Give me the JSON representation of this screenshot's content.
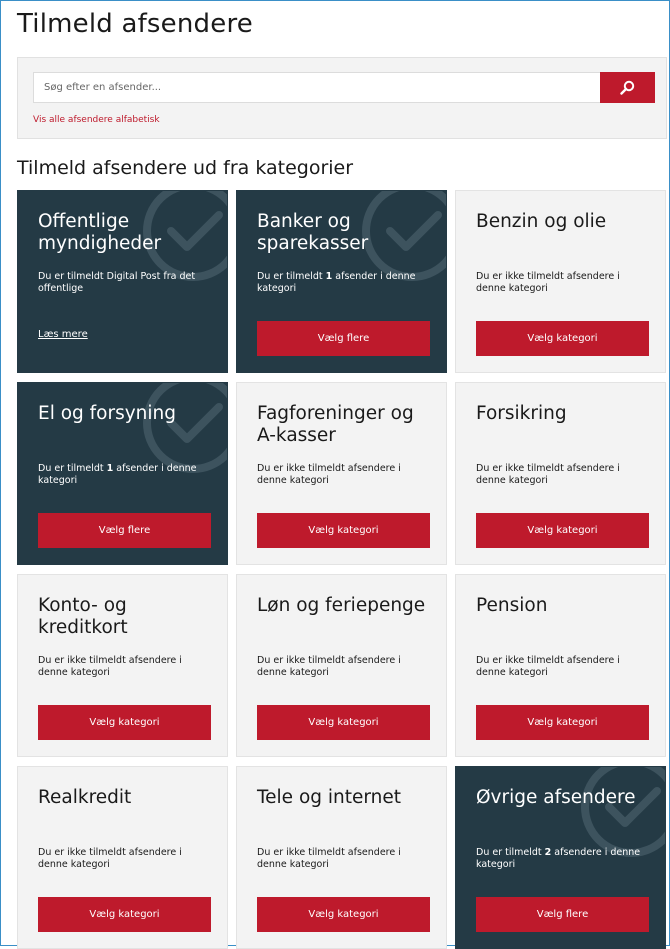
{
  "page": {
    "title": "Tilmeld afsendere",
    "section_title": "Tilmeld afsendere ud fra kategorier"
  },
  "search": {
    "placeholder": "Søg efter en afsender...",
    "button_icon": "search-icon",
    "alpha_link": "Vis alle afsendere alfabetisk"
  },
  "colors": {
    "accent": "#be1a2c",
    "dark_card": "#243a45",
    "light_card": "#f3f3f3",
    "frame": "#3a8fc7"
  },
  "categories": [
    {
      "title": "Offentlige myndigheder",
      "subscribed": true,
      "text_before": "Du er tilmeldt Digital Post fra det offentlige",
      "count": "",
      "text_after": "",
      "action_type": "link",
      "action_label": "Læs mere"
    },
    {
      "title": "Banker og sparekasser",
      "subscribed": true,
      "text_before": "Du er tilmeldt ",
      "count": "1",
      "text_after": " afsender i denne kategori",
      "action_type": "button",
      "action_label": "Vælg flere"
    },
    {
      "title": "Benzin og olie",
      "subscribed": false,
      "text_before": "Du er ikke tilmeldt afsendere i denne kategori",
      "count": "",
      "text_after": "",
      "action_type": "button",
      "action_label": "Vælg kategori"
    },
    {
      "title": "El og forsyning",
      "subscribed": true,
      "text_before": "Du er tilmeldt ",
      "count": "1",
      "text_after": " afsender i denne kategori",
      "action_type": "button",
      "action_label": "Vælg flere"
    },
    {
      "title": "Fagforeninger og A-kasser",
      "subscribed": false,
      "text_before": "Du er ikke tilmeldt afsendere i denne kategori",
      "count": "",
      "text_after": "",
      "action_type": "button",
      "action_label": "Vælg kategori"
    },
    {
      "title": "Forsikring",
      "subscribed": false,
      "text_before": "Du er ikke tilmeldt afsendere i denne kategori",
      "count": "",
      "text_after": "",
      "action_type": "button",
      "action_label": "Vælg kategori"
    },
    {
      "title": "Konto- og kreditkort",
      "subscribed": false,
      "text_before": "Du er ikke tilmeldt afsendere i denne kategori",
      "count": "",
      "text_after": "",
      "action_type": "button",
      "action_label": "Vælg kategori"
    },
    {
      "title": "Løn og feriepenge",
      "subscribed": false,
      "text_before": "Du er ikke tilmeldt afsendere i denne kategori",
      "count": "",
      "text_after": "",
      "action_type": "button",
      "action_label": "Vælg kategori"
    },
    {
      "title": "Pension",
      "subscribed": false,
      "text_before": "Du er ikke tilmeldt afsendere i denne kategori",
      "count": "",
      "text_after": "",
      "action_type": "button",
      "action_label": "Vælg kategori"
    },
    {
      "title": "Realkredit",
      "subscribed": false,
      "text_before": "Du er ikke tilmeldt afsendere i denne kategori",
      "count": "",
      "text_after": "",
      "action_type": "button",
      "action_label": "Vælg kategori"
    },
    {
      "title": "Tele og internet",
      "subscribed": false,
      "text_before": "Du er ikke tilmeldt afsendere i denne kategori",
      "count": "",
      "text_after": "",
      "action_type": "button",
      "action_label": "Vælg kategori"
    },
    {
      "title": "Øvrige afsendere",
      "subscribed": true,
      "text_before": "Du er tilmeldt ",
      "count": "2",
      "text_after": " afsendere i denne kategori",
      "action_type": "button",
      "action_label": "Vælg flere"
    }
  ]
}
